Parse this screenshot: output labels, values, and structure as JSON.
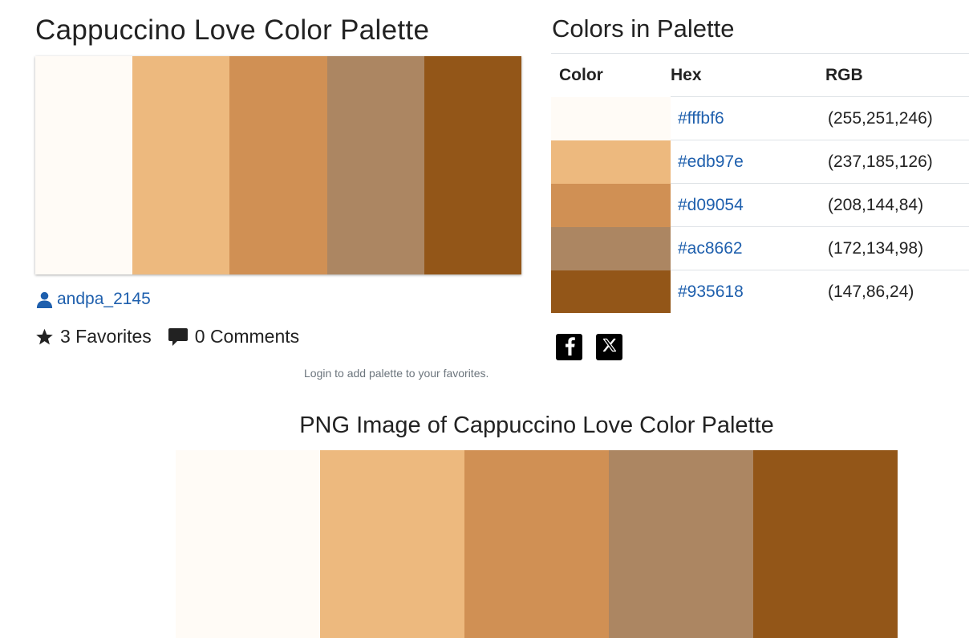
{
  "palette": {
    "title": "Cappuccino Love Color Palette",
    "author": "andpa_2145",
    "favorites_label": "3 Favorites",
    "comments_label": "0 Comments",
    "login_note": "Login to add palette to your favorites."
  },
  "colors_section": {
    "title": "Colors in Palette",
    "headers": {
      "color": "Color",
      "hex": "Hex",
      "rgb": "RGB"
    },
    "rows": [
      {
        "hex": "#fffbf6",
        "rgb": "(255,251,246)"
      },
      {
        "hex": "#edb97e",
        "rgb": "(237,185,126)"
      },
      {
        "hex": "#d09054",
        "rgb": "(208,144,84)"
      },
      {
        "hex": "#ac8662",
        "rgb": "(172,134,98)"
      },
      {
        "hex": "#935618",
        "rgb": "(147,86,24)"
      }
    ]
  },
  "share": {
    "icons": [
      "facebook-icon",
      "x-icon"
    ]
  },
  "png_section": {
    "title": "PNG Image of Cappuccino Love Color Palette"
  },
  "theme": {
    "link_color": "#1e5fad",
    "text_color": "#222222",
    "muted_color": "#6c757d"
  }
}
